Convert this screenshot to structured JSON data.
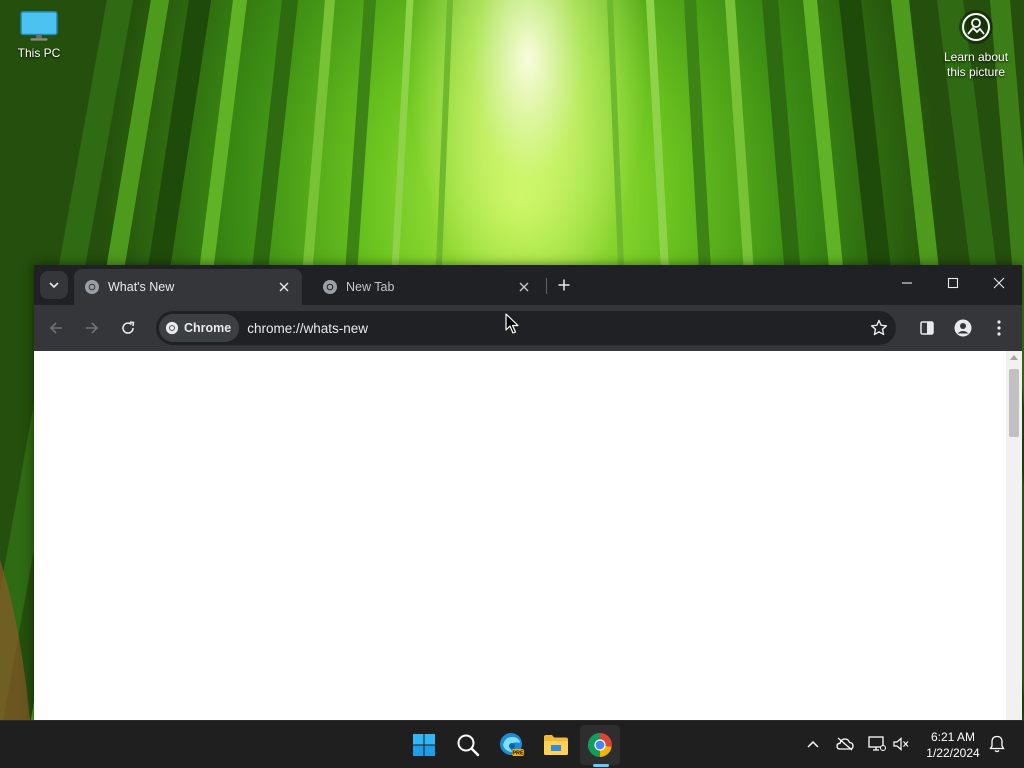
{
  "desktop": {
    "icons": [
      {
        "label": "This PC",
        "icon": "monitor-icon"
      }
    ],
    "spotlight": {
      "label": "Learn about this picture",
      "icon": "camera-info-icon"
    }
  },
  "browser": {
    "tabs": [
      {
        "title": "What's New",
        "active": true,
        "icon": "chrome-favicon-icon"
      },
      {
        "title": "New Tab",
        "active": false,
        "icon": "chrome-favicon-icon"
      }
    ],
    "omnibox": {
      "chip_label": "Chrome",
      "url": "chrome://whats-new"
    },
    "theme": {
      "frame": "#202124",
      "toolbar": "#35363a"
    }
  },
  "taskbar": {
    "apps": [
      {
        "name": "Start",
        "icon": "windows-start-icon"
      },
      {
        "name": "Search",
        "icon": "search-icon"
      },
      {
        "name": "Microsoft Edge Preview",
        "icon": "edge-pre-icon"
      },
      {
        "name": "File Explorer",
        "icon": "folder-icon"
      },
      {
        "name": "Google Chrome",
        "icon": "chrome-icon",
        "active": true
      }
    ],
    "clock": {
      "time": "6:21 AM",
      "date": "1/22/2024"
    },
    "accent": "#60cdff"
  }
}
